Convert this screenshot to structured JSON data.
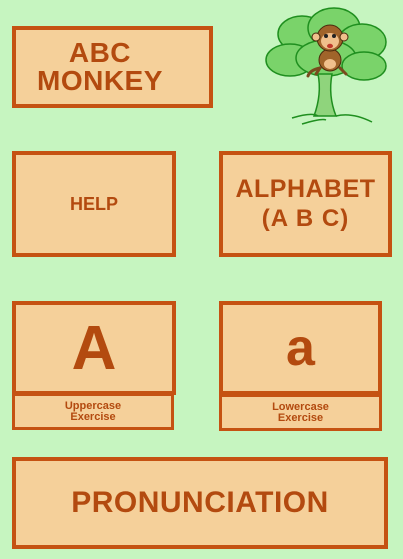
{
  "app": {
    "title_line1": "ABC",
    "title_line2": "MONKEY"
  },
  "menu": {
    "help_label": "HELP",
    "alphabet_line1": "ALPHABET",
    "alphabet_line2": "(A B C)",
    "uppercase_glyph": "A",
    "uppercase_caption_line1": "Uppercase",
    "uppercase_caption_line2": "Exercise",
    "lowercase_glyph": "a",
    "lowercase_caption_line1": "Lowercase",
    "lowercase_caption_line2": "Exercise",
    "pronunciation_label": "PRONUNCIATION"
  },
  "colors": {
    "background": "#c6f5c0",
    "tile_fill": "#f5d09a",
    "tile_border": "#c55212",
    "text": "#b34a0f"
  },
  "icons": {
    "mascot": "monkey-in-tree-icon"
  }
}
